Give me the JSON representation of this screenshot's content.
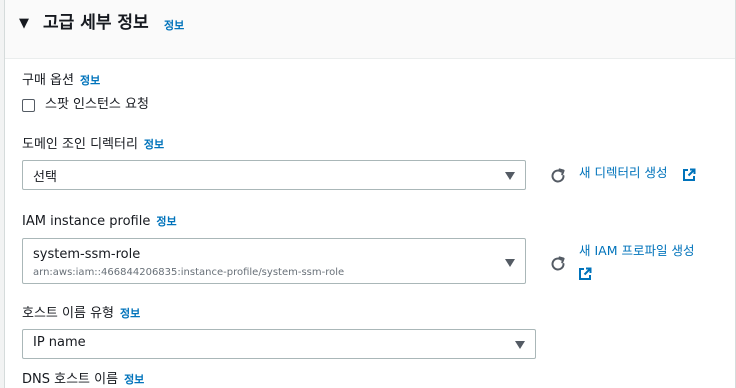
{
  "section": {
    "toggle_glyph": "▼",
    "title": "고급 세부 정보",
    "info_label": "정보"
  },
  "purchase_option": {
    "label": "구매 옵션",
    "info_label": "정보",
    "checkbox_label": "스팟 인스턴스 요청",
    "checked": false
  },
  "domain_join": {
    "label": "도메인 조인 디렉터리",
    "info_label": "정보",
    "value": "선택",
    "create_link": "새 디렉터리 생성"
  },
  "iam_profile": {
    "label": "IAM instance profile",
    "info_label": "정보",
    "value": "system-ssm-role",
    "arn": "arn:aws:iam::466844206835:instance-profile/system-ssm-role",
    "create_link": "새 IAM 프로파일 생성"
  },
  "hostname_type": {
    "label": "호스트 이름 유형",
    "info_label": "정보",
    "value": "IP name"
  },
  "dns_hostname": {
    "label": "DNS 호스트 이름",
    "info_label": "정보"
  },
  "icons": {
    "toggle": "caret-down-icon",
    "refresh": "refresh-icon",
    "external": "external-link-icon",
    "dropdown": "dropdown-caret-icon"
  },
  "colors": {
    "link": "#0073bb",
    "border": "#aab7b8",
    "header_bg": "#fafafa"
  }
}
